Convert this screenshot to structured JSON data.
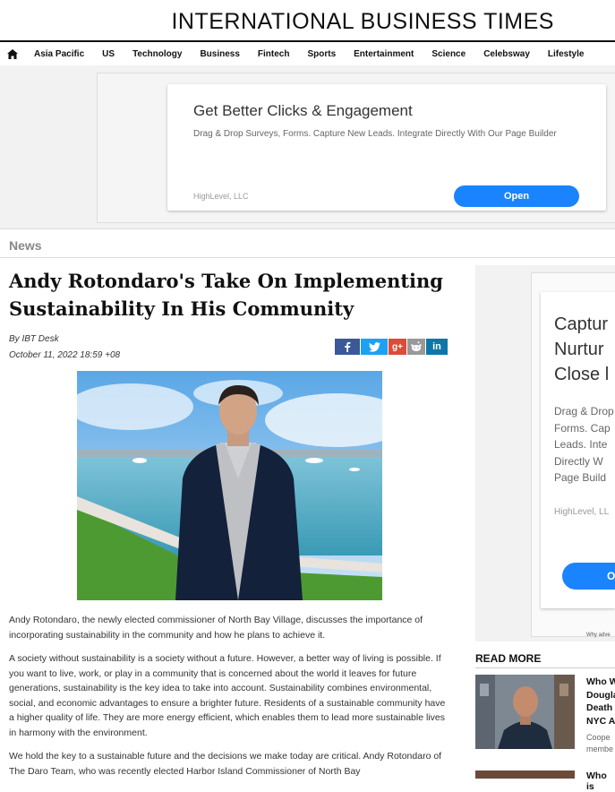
{
  "site": {
    "title": "INTERNATIONAL BUSINESS TIMES"
  },
  "nav": {
    "home_icon": "home-icon",
    "items": [
      "Asia Pacific",
      "US",
      "Technology",
      "Business",
      "Fintech",
      "Sports",
      "Entertainment",
      "Science",
      "Celebsway",
      "Lifestyle"
    ]
  },
  "top_ad": {
    "title": "Get Better Clicks & Engagement",
    "description": "Drag & Drop Surveys, Forms. Capture New Leads. Integrate Directly With Our Page Builder",
    "advertiser": "HighLevel, LLC",
    "cta": "Open"
  },
  "section": "News",
  "article": {
    "headline": "Andy Rotondaro's Take On Implementing Sustainability In His Community",
    "byline": "By IBT Desk",
    "date": "October 11, 2022 18:59 +08",
    "share": [
      {
        "icon": "facebook-icon",
        "glyph": "f",
        "color": "#3b5998"
      },
      {
        "icon": "twitter-icon",
        "glyph": "t",
        "color": "#1da1f2"
      },
      {
        "icon": "google-plus-icon",
        "glyph": "g+",
        "color": "#dd4b39"
      },
      {
        "icon": "reddit-icon",
        "glyph": "r",
        "color": "#999999"
      },
      {
        "icon": "linkedin-icon",
        "glyph": "in",
        "color": "#0e76a8"
      }
    ],
    "paragraphs": [
      "Andy Rotondaro, the newly elected commissioner of North Bay Village, discusses the importance of incorporating sustainability in the community and how he plans to achieve it.",
      "A society without sustainability is a society without a future. However, a better way of living is possible. If you want to live, work, or play in a community that is concerned about the world it leaves for future generations, sustainability is the key idea to take into account. Sustainability combines environmental, social, and economic advantages to ensure a brighter future. Residents of a sustainable community have a higher quality of life. They are more energy efficient, which enables them to lead more sustainable lives in harmony with the environment.",
      "We hold the key to a sustainable future and the decisions we make today are critical. Andy Rotondaro of The Daro Team, who was recently elected Harbor Island Commissioner of North Bay"
    ]
  },
  "side_ad": {
    "title": "Captur\nNurtur\nClose l",
    "description": "Drag & Drop\nForms. Cap\nLeads. Inte\nDirectly W\nPage Build",
    "advertiser": "HighLevel, LL",
    "cta": "O",
    "why": "Why adve"
  },
  "read_more": {
    "heading": "READ MORE",
    "items": [
      {
        "title": "Who W\nDougla\nDeath\nNYC A",
        "desc": "Coope\nmembe"
      },
      {
        "title": "Who is"
      }
    ]
  }
}
